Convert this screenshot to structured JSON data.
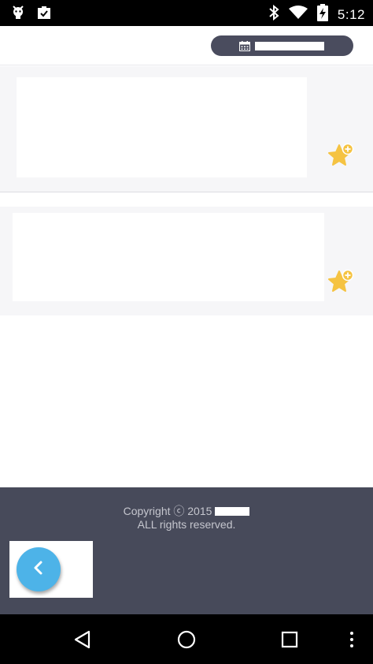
{
  "status_bar": {
    "time": "5:12",
    "left_icons": [
      "android-debug-icon",
      "clipboard-check-icon"
    ],
    "right_icons": [
      "bluetooth-icon",
      "wifi-icon",
      "battery-charging-icon"
    ]
  },
  "header": {
    "date_icon": "calendar-icon"
  },
  "cards": [
    {
      "favorite_icon": "star-plus-icon"
    },
    {
      "favorite_icon": "star-plus-icon"
    }
  ],
  "footer": {
    "copyright_line1": "Copyright ⓒ 2015",
    "copyright_line2": "ALL rights reserved.",
    "back_icon": "chevron-left-icon"
  },
  "nav_bar": {
    "items": [
      "back-triangle-icon",
      "home-circle-icon",
      "recents-square-icon",
      "overflow-menu-icon"
    ]
  },
  "colors": {
    "accent_blue": "#4db3e8",
    "star_yellow": "#f5c342",
    "footer_bg": "#474a5a",
    "pill_bg": "#4a4c5e"
  }
}
